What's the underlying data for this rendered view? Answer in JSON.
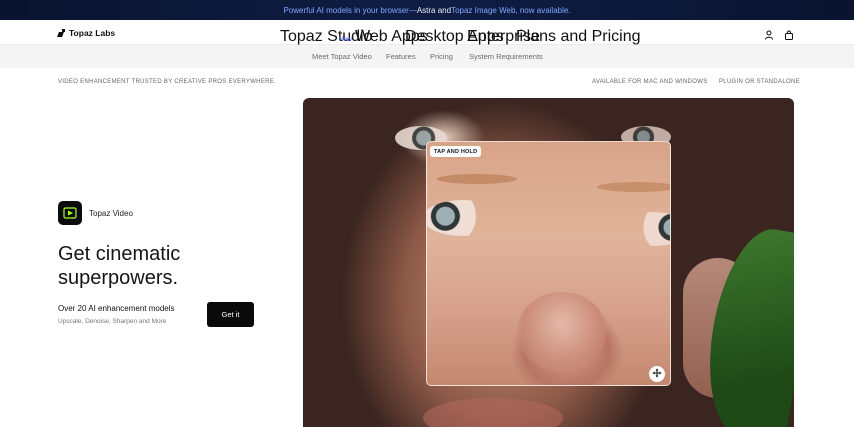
{
  "banner": {
    "part1": "Powerful AI models in your browser—",
    "part2": "Astra and ",
    "part3": "Topaz Image Web, now available."
  },
  "logo": {
    "text": "Topaz Labs"
  },
  "nav": {
    "topaz_studio": "Topaz Studio",
    "new_badge": "New",
    "web_apps": "Web Apps",
    "desktop_apps": "Desktop Apps",
    "enterprise": "Enterprise",
    "plans_pricing": "Plans and Pricing",
    "icons": [
      "user-icon",
      "bag-icon"
    ]
  },
  "subnav": {
    "meet": "Meet Topaz Video",
    "features": "Features",
    "pricing": "Pricing",
    "requirements": "System Requirements"
  },
  "trust": {
    "left": "VIDEO ENHANCEMENT TRUSTED BY CREATIVE PROS EVERYWHERE.",
    "middle": "AVAILABLE FOR MAC AND WINDOWS",
    "right": "PLUGIN OR STANDALONE"
  },
  "product": {
    "name": "Topaz Video",
    "headline_line1": "Get cinematic",
    "headline_line2": "superpowers.",
    "desc_main": "Over 20 AI enhancement models",
    "desc_sub": "Upscale, Denoise, Sharpen and More",
    "cta": "Get it"
  },
  "hero": {
    "tap_badge": "TAP AND HOLD"
  },
  "colors": {
    "banner_bg": "#0a1430",
    "banner_accent": "#7fa7ff",
    "new_badge": "#4c6bff",
    "cta_bg": "#0a0a0a",
    "app_icon_accent": "#a8ff2e"
  }
}
